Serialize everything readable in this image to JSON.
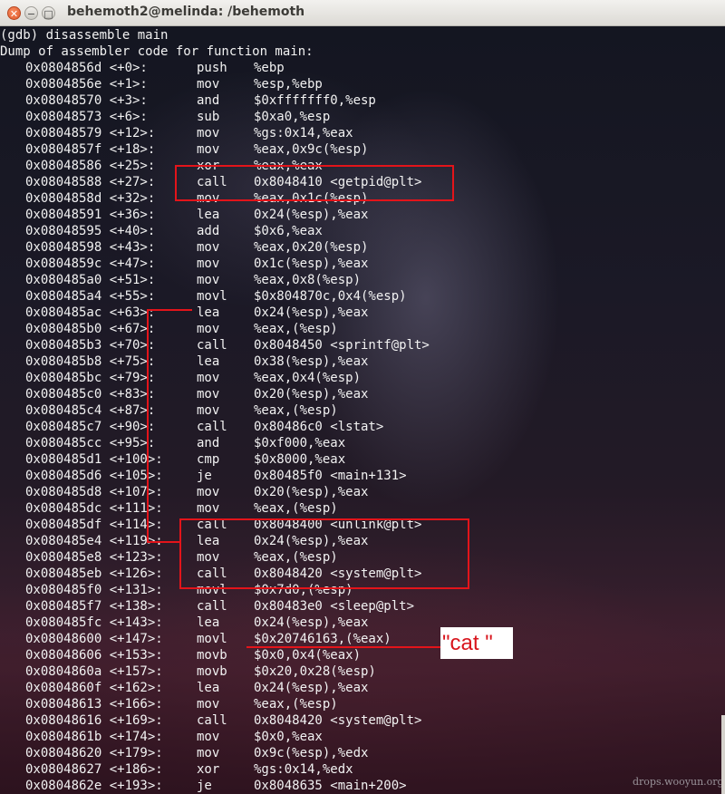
{
  "window": {
    "title": "behemoth2@melinda: /behemoth",
    "close_label": "✕",
    "minimize_label": "−",
    "maximize_label": "□"
  },
  "terminal": {
    "header": [
      "(gdb) disassemble main",
      "Dump of assembler code for function main:"
    ],
    "lines": [
      {
        "addr": "0x0804856d <+0>:",
        "mnem": "push",
        "ops": "%ebp"
      },
      {
        "addr": "0x0804856e <+1>:",
        "mnem": "mov",
        "ops": "%esp,%ebp"
      },
      {
        "addr": "0x08048570 <+3>:",
        "mnem": "and",
        "ops": "$0xfffffff0,%esp"
      },
      {
        "addr": "0x08048573 <+6>:",
        "mnem": "sub",
        "ops": "$0xa0,%esp"
      },
      {
        "addr": "0x08048579 <+12>:",
        "mnem": "mov",
        "ops": "%gs:0x14,%eax"
      },
      {
        "addr": "0x0804857f <+18>:",
        "mnem": "mov",
        "ops": "%eax,0x9c(%esp)"
      },
      {
        "addr": "0x08048586 <+25>:",
        "mnem": "xor",
        "ops": "%eax,%eax"
      },
      {
        "addr": "0x08048588 <+27>:",
        "mnem": "call",
        "ops": "0x8048410 <getpid@plt>"
      },
      {
        "addr": "0x0804858d <+32>:",
        "mnem": "mov",
        "ops": "%eax,0x1c(%esp)"
      },
      {
        "addr": "0x08048591 <+36>:",
        "mnem": "lea",
        "ops": "0x24(%esp),%eax"
      },
      {
        "addr": "0x08048595 <+40>:",
        "mnem": "add",
        "ops": "$0x6,%eax"
      },
      {
        "addr": "0x08048598 <+43>:",
        "mnem": "mov",
        "ops": "%eax,0x20(%esp)"
      },
      {
        "addr": "0x0804859c <+47>:",
        "mnem": "mov",
        "ops": "0x1c(%esp),%eax"
      },
      {
        "addr": "0x080485a0 <+51>:",
        "mnem": "mov",
        "ops": "%eax,0x8(%esp)"
      },
      {
        "addr": "0x080485a4 <+55>:",
        "mnem": "movl",
        "ops": "$0x804870c,0x4(%esp)"
      },
      {
        "addr": "0x080485ac <+63>:",
        "mnem": "lea",
        "ops": "0x24(%esp),%eax"
      },
      {
        "addr": "0x080485b0 <+67>:",
        "mnem": "mov",
        "ops": "%eax,(%esp)"
      },
      {
        "addr": "0x080485b3 <+70>:",
        "mnem": "call",
        "ops": "0x8048450 <sprintf@plt>"
      },
      {
        "addr": "0x080485b8 <+75>:",
        "mnem": "lea",
        "ops": "0x38(%esp),%eax"
      },
      {
        "addr": "0x080485bc <+79>:",
        "mnem": "mov",
        "ops": "%eax,0x4(%esp)"
      },
      {
        "addr": "0x080485c0 <+83>:",
        "mnem": "mov",
        "ops": "0x20(%esp),%eax"
      },
      {
        "addr": "0x080485c4 <+87>:",
        "mnem": "mov",
        "ops": "%eax,(%esp)"
      },
      {
        "addr": "0x080485c7 <+90>:",
        "mnem": "call",
        "ops": "0x80486c0 <lstat>"
      },
      {
        "addr": "0x080485cc <+95>:",
        "mnem": "and",
        "ops": "$0xf000,%eax"
      },
      {
        "addr": "0x080485d1 <+100>:",
        "mnem": "cmp",
        "ops": "$0x8000,%eax"
      },
      {
        "addr": "0x080485d6 <+105>:",
        "mnem": "je",
        "ops": "0x80485f0 <main+131>"
      },
      {
        "addr": "0x080485d8 <+107>:",
        "mnem": "mov",
        "ops": "0x20(%esp),%eax"
      },
      {
        "addr": "0x080485dc <+111>:",
        "mnem": "mov",
        "ops": "%eax,(%esp)"
      },
      {
        "addr": "0x080485df <+114>:",
        "mnem": "call",
        "ops": "0x8048400 <unlink@plt>"
      },
      {
        "addr": "0x080485e4 <+119>:",
        "mnem": "lea",
        "ops": "0x24(%esp),%eax"
      },
      {
        "addr": "0x080485e8 <+123>:",
        "mnem": "mov",
        "ops": "%eax,(%esp)"
      },
      {
        "addr": "0x080485eb <+126>:",
        "mnem": "call",
        "ops": "0x8048420 <system@plt>"
      },
      {
        "addr": "0x080485f0 <+131>:",
        "mnem": "movl",
        "ops": "$0x7d0,(%esp)"
      },
      {
        "addr": "0x080485f7 <+138>:",
        "mnem": "call",
        "ops": "0x80483e0 <sleep@plt>"
      },
      {
        "addr": "0x080485fc <+143>:",
        "mnem": "lea",
        "ops": "0x24(%esp),%eax"
      },
      {
        "addr": "0x08048600 <+147>:",
        "mnem": "movl",
        "ops": "$0x20746163,(%eax)"
      },
      {
        "addr": "0x08048606 <+153>:",
        "mnem": "movb",
        "ops": "$0x0,0x4(%eax)"
      },
      {
        "addr": "0x0804860a <+157>:",
        "mnem": "movb",
        "ops": "$0x20,0x28(%esp)"
      },
      {
        "addr": "0x0804860f <+162>:",
        "mnem": "lea",
        "ops": "0x24(%esp),%eax"
      },
      {
        "addr": "0x08048613 <+166>:",
        "mnem": "mov",
        "ops": "%eax,(%esp)"
      },
      {
        "addr": "0x08048616 <+169>:",
        "mnem": "call",
        "ops": "0x8048420 <system@plt>"
      },
      {
        "addr": "0x0804861b <+174>:",
        "mnem": "mov",
        "ops": "$0x0,%eax"
      },
      {
        "addr": "0x08048620 <+179>:",
        "mnem": "mov",
        "ops": "0x9c(%esp),%edx"
      },
      {
        "addr": "0x08048627 <+186>:",
        "mnem": "xor",
        "ops": "%gs:0x14,%edx"
      },
      {
        "addr": "0x0804862e <+193>:",
        "mnem": "je",
        "ops": "0x8048635 <main+200>"
      }
    ]
  },
  "annotation": {
    "note": "\"cat \"",
    "color": "#e3141a"
  },
  "watermark": "drops.wooyun.org",
  "colors": {
    "terminal_text": "#f2f2f2",
    "highlight": "#e3141a",
    "close_button": "#e05a2b"
  }
}
